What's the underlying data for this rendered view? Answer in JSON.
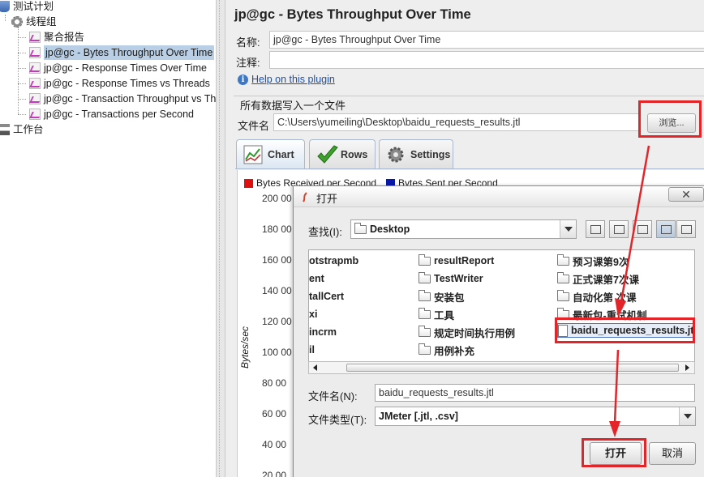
{
  "tree": {
    "items": [
      {
        "label": "测试计划",
        "icon": "test-plan-icon"
      },
      {
        "label": "线程组",
        "icon": "gear-icon"
      },
      {
        "label": "聚合报告",
        "icon": "graph-icon"
      },
      {
        "label": "jp@gc - Bytes Throughput Over Time",
        "icon": "graph-icon",
        "selected": true
      },
      {
        "label": "jp@gc - Response Times Over Time",
        "icon": "graph-icon"
      },
      {
        "label": "jp@gc - Response Times vs Threads",
        "icon": "graph-icon"
      },
      {
        "label": "jp@gc - Transaction Throughput vs Thr",
        "icon": "graph-icon"
      },
      {
        "label": "jp@gc - Transactions per Second",
        "icon": "graph-icon"
      },
      {
        "label": "工作台",
        "icon": "workbench-icon"
      }
    ]
  },
  "panel": {
    "title": "jp@gc - Bytes Throughput Over Time",
    "name_label": "名称:",
    "name_value": "jp@gc - Bytes Throughput Over Time",
    "comment_label": "注释:",
    "comment_value": "",
    "help_link": "Help on this plugin",
    "file_group_title": "所有数据写入一个文件",
    "file_label": "文件名",
    "file_value": "C:\\Users\\yumeiling\\Desktop\\baidu_requests_results.jtl",
    "browse_label": "浏览..."
  },
  "tabs": [
    {
      "label": "Chart",
      "icon": "chart-icon",
      "active": true
    },
    {
      "label": "Rows",
      "icon": "checkmark-icon",
      "active": false
    },
    {
      "label": "Settings",
      "icon": "gear-icon",
      "active": false
    }
  ],
  "chart": {
    "legend": [
      {
        "label": "Bytes Received per Second",
        "color": "#e01010"
      },
      {
        "label": "Bytes Sent per Second",
        "color": "#0a1aa8"
      }
    ],
    "ylabel": "Bytes/sec",
    "yticks": [
      "200 00",
      "180 00",
      "160 00",
      "140 00",
      "120 00",
      "100 00",
      "80 00",
      "60 00",
      "40 00",
      "20 00"
    ]
  },
  "dialog": {
    "title": "打开",
    "close_label": "✕",
    "lookin_label": "查找(I):",
    "lookin_value": "Desktop",
    "files": [
      {
        "name": "otstrapmb",
        "type": "folder"
      },
      {
        "name": "ent",
        "type": "folder"
      },
      {
        "name": "tallCert",
        "type": "folder"
      },
      {
        "name": "xi",
        "type": "folder"
      },
      {
        "name": "incrm",
        "type": "folder"
      },
      {
        "name": "il",
        "type": "folder"
      },
      {
        "name": "resultReport",
        "type": "folder"
      },
      {
        "name": "TestWriter",
        "type": "folder"
      },
      {
        "name": "安装包",
        "type": "folder"
      },
      {
        "name": "工具",
        "type": "folder"
      },
      {
        "name": "规定时间执行用例",
        "type": "folder"
      },
      {
        "name": "用例补充",
        "type": "folder"
      },
      {
        "name": "预习课第9次",
        "type": "folder"
      },
      {
        "name": "正式课第7次课",
        "type": "folder"
      },
      {
        "name": "自动化第 次课",
        "type": "folder"
      },
      {
        "name": "最新包-重试机制",
        "type": "folder"
      },
      {
        "name": "baidu_requests_results.jtl",
        "type": "file",
        "selected": true
      }
    ],
    "filename_label": "文件名(N):",
    "filename_value": "baidu_requests_results.jtl",
    "filetype_label": "文件类型(T):",
    "filetype_value": "JMeter [.jtl, .csv]",
    "open_label": "打开",
    "cancel_label": "取消"
  },
  "annotations": {
    "highlight_color": "#e3252a"
  }
}
